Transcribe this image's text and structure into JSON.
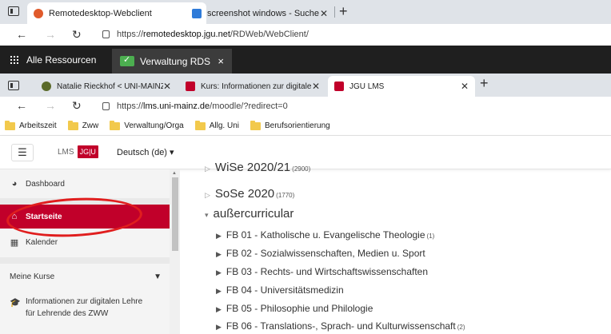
{
  "outer_browser": {
    "tabs": [
      {
        "title": "Remotedesktop-Webclient",
        "active": true,
        "favicon_color": "#e05a2b"
      },
      {
        "title": "screenshot windows - Suche",
        "active": false,
        "favicon_color": "#2f7bd9"
      }
    ],
    "url_prefix": "https://",
    "url_host": "remotedesktop.jgu.net",
    "url_path": "/RDWeb/WebClient/"
  },
  "rds": {
    "all_resources_label": "Alle Ressourcen",
    "tab_label": "Verwaltung RDS",
    "close_glyph": "×"
  },
  "inner_browser": {
    "tabs": [
      {
        "title": "Natalie Rieckhof < UNI-MAINZ >",
        "favicon_color": "#5a6a2a"
      },
      {
        "title": "Kurs: Informationen zur digitalen",
        "favicon_color": "#c1002a"
      },
      {
        "title": "JGU LMS",
        "favicon_color": "#c1002a",
        "active": true
      }
    ],
    "url_prefix": "https://",
    "url_host": "lms.uni-mainz.de",
    "url_path": "/moodle/?redirect=0",
    "bookmarks": [
      "Arbeitszeit",
      "Zww",
      "Verwaltung/Orga",
      "Allg. Uni",
      "Berufsorientierung"
    ]
  },
  "moodle": {
    "logo_lms": "LMS",
    "logo_jgu": "JG|U",
    "language": "Deutsch (de) ▾",
    "sidebar": {
      "dashboard": "Dashboard",
      "startseite": "Startseite",
      "kalender": "Kalender",
      "meine_kurse": "Meine Kurse",
      "course_line1": "Informationen zur digitalen Lehre",
      "course_line2": "für Lehrende des ZWW"
    },
    "categories": [
      {
        "label": "WiSe 2020/21",
        "count": "(2900)"
      },
      {
        "label": "SoSe 2020",
        "count": "(1770)"
      },
      {
        "label": "außercurricular",
        "count": ""
      }
    ],
    "subcategories": [
      {
        "label": "FB 01 - Katholische u. Evangelische Theologie",
        "count": "(1)"
      },
      {
        "label": "FB 02 - Sozialwissenschaften, Medien u. Sport",
        "count": ""
      },
      {
        "label": "FB 03 - Rechts- und Wirtschaftswissenschaften",
        "count": ""
      },
      {
        "label": "FB 04 - Universitätsmedizin",
        "count": ""
      },
      {
        "label": "FB 05 - Philosophie und Philologie",
        "count": ""
      },
      {
        "label": "FB 06 - Translations-, Sprach- und Kulturwissenschaft",
        "count": "(2)"
      }
    ]
  }
}
